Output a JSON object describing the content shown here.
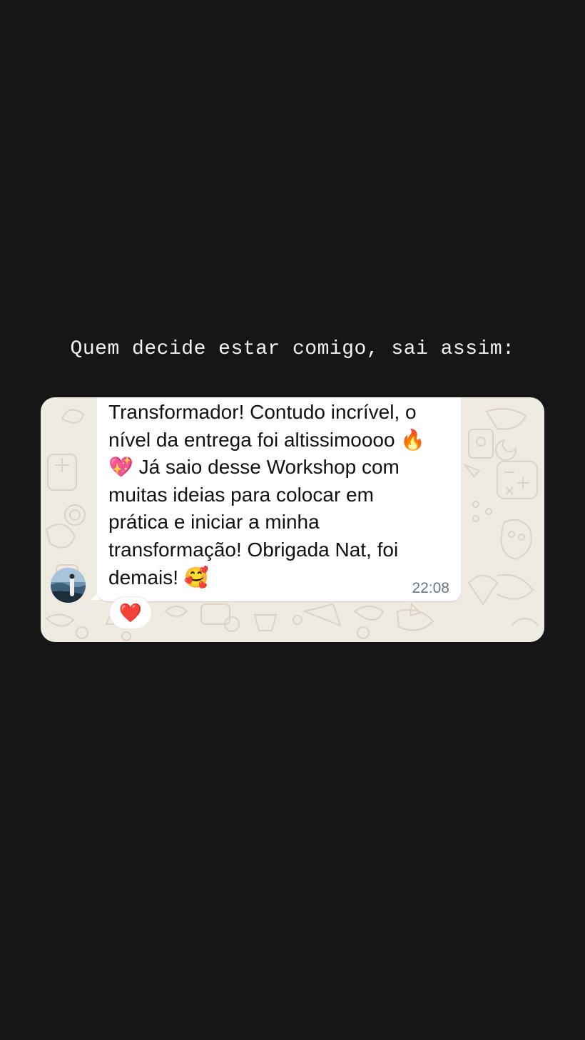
{
  "headline": "Quem decide estar comigo, sai assim:",
  "chat": {
    "message": {
      "text": "Transformador! Contudo incrível, o\nnível da entrega foi altissimoooo 🔥\n💖 Já saio desse Workshop com\nmuitas ideias para colocar em\nprática e iniciar a minha\ntransformação! Obrigada Nat, foi\ndemais! 🥰",
      "time": "22:08",
      "reaction": "❤️"
    }
  },
  "colors": {
    "background": "#161616",
    "chat_wallpaper": "#efeae2",
    "wallpaper_doodle": "#ddd3c4",
    "bubble": "#ffffff",
    "text": "#111111",
    "timestamp": "#667781"
  },
  "icons": {
    "avatar": "profile-photo",
    "reaction": "red-heart"
  }
}
